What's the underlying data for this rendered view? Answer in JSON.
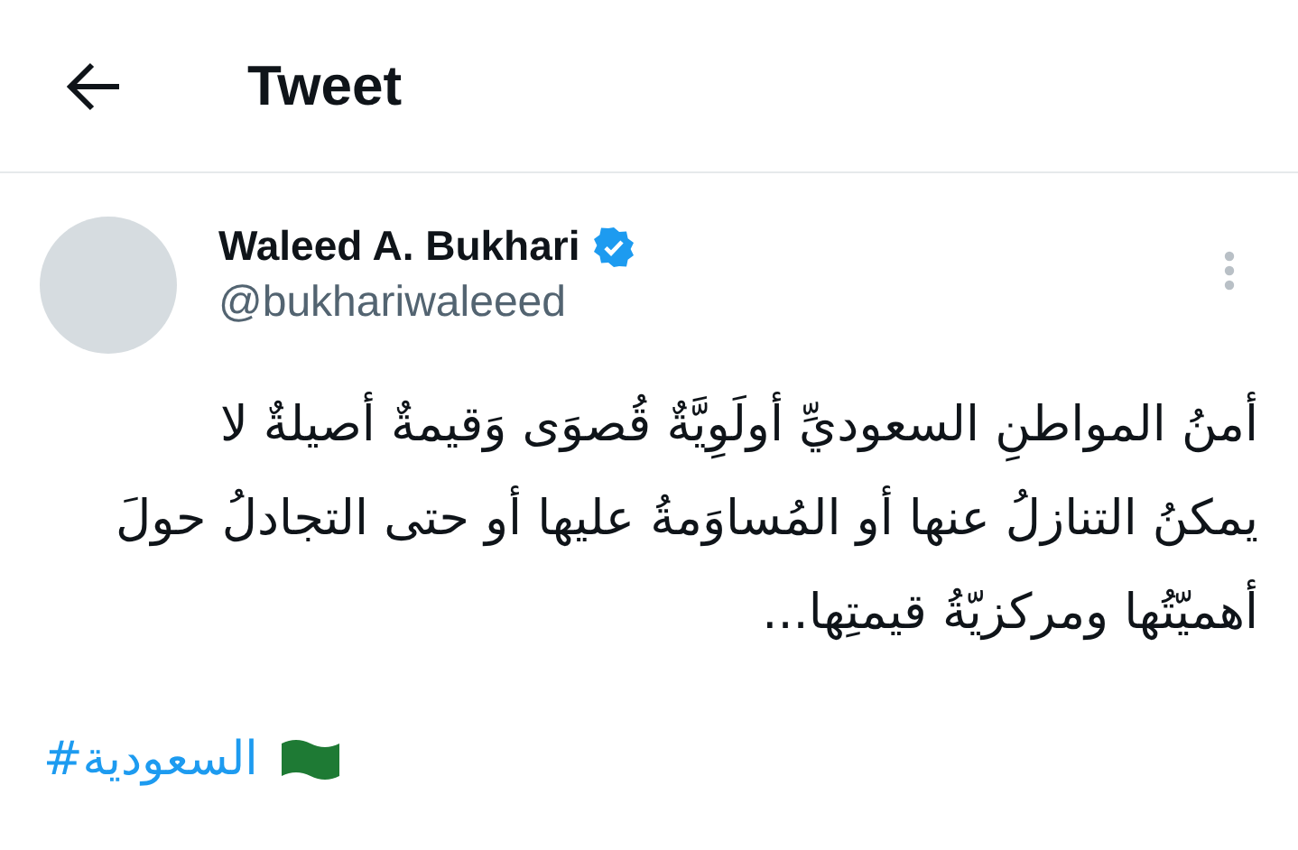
{
  "header": {
    "title": "Tweet"
  },
  "author": {
    "name": "Waleed A. Bukhari",
    "verified": true,
    "handle": "@bukhariwaleeed"
  },
  "tweet": {
    "text": "أمنُ المواطنِ السعوديِّ أولَوِيَّةٌ قُصوَى وَقيمةٌ أصيلةٌ لا يمكنُ التنازلُ عنها أو المُساوَمةُ عليها أو حتى التجادلُ حولَ أهميّتُها ومركزيّةُ قيمتِها...",
    "hashtag": "#السعودية"
  }
}
